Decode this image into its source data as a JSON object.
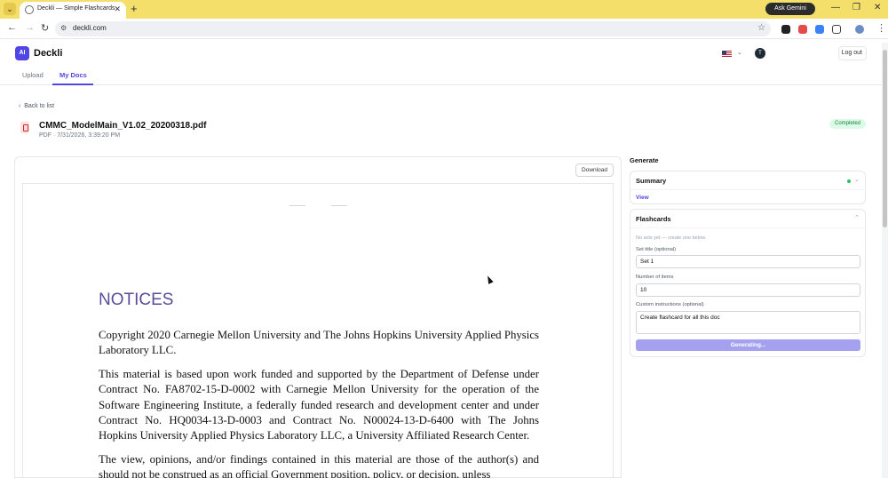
{
  "browser": {
    "tab_title": "Deckli — Simple Flashcards",
    "ask_gemini": "Ask Gemini",
    "url": "deckli.com"
  },
  "app": {
    "logo": "AI",
    "name": "Deckli",
    "user_initial": "T",
    "logout": "Log out",
    "tabs": [
      "Upload",
      "My Docs"
    ]
  },
  "doc": {
    "back": "Back to list",
    "title": "CMMC_ModelMain_V1.02_20200318.pdf",
    "meta": "PDF · 7/31/2026, 3:39:20 PM",
    "status": "Completed",
    "download": "Download",
    "heading": "NOTICES",
    "paragraphs": [
      "Copyright 2020 Carnegie Mellon University and The Johns Hopkins University Applied Physics Laboratory LLC.",
      "This material is based upon work funded and supported by the Department of Defense under Contract No. FA8702-15-D-0002 with Carnegie Mellon University for the operation of the Software Engineering Institute, a federally funded research and development center and under Contract No. HQ0034-13-D-0003 and Contract No. N00024-13-D-6400 with The Johns Hopkins University Applied Physics Laboratory LLC, a University Affiliated Research Center.",
      "The view, opinions, and/or findings contained in this material are those of the author(s) and should not be construed as an official Government position, policy, or decision, unless"
    ]
  },
  "generate": {
    "title": "Generate",
    "summary": {
      "title": "Summary",
      "view": "View"
    },
    "flashcards": {
      "title": "Flashcards",
      "empty": "No sets yet — create one below.",
      "set_title_label": "Set title (optional)",
      "set_title_value": "Set 1",
      "num_items_label": "Number of items",
      "num_items_value": "10",
      "instructions_label": "Custom instructions (optional)",
      "instructions_value": "Create flashcard for all this doc",
      "button": "Generating..."
    }
  }
}
